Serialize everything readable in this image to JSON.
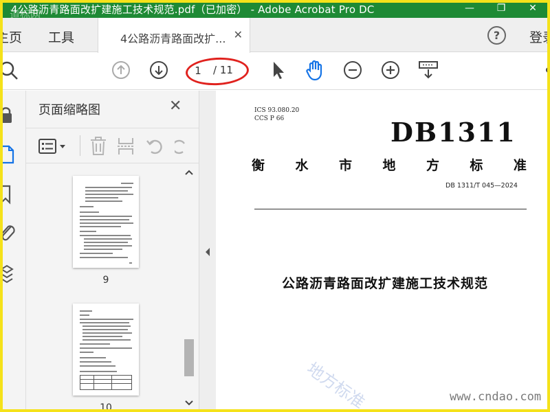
{
  "window": {
    "title": "4公路沥青路面改扩建施工技术规范.pdf（已加密） - Adobe Acrobat Pro DC",
    "watermark": "道标网",
    "minimize_glyph": "—",
    "restore_glyph": "❐",
    "close_glyph": "✕"
  },
  "menu": {
    "home": "主页",
    "tools": "工具",
    "doc_tab": "4公路沥青路面改扩...",
    "tab_close": "✕",
    "help": "?",
    "login": "登录"
  },
  "toolbar": {
    "current_page": "1",
    "total_pages": "/ 11"
  },
  "thumbnails": {
    "title": "页面缩略图",
    "close": "✕",
    "pages": [
      {
        "label": "9"
      },
      {
        "label": "10"
      }
    ]
  },
  "document": {
    "ics": "ICS  93.080.20",
    "ccs": "CCS  P 66",
    "db_code": "DB1311",
    "spaced_title": [
      "衡",
      "水",
      "市",
      "地",
      "方",
      "标",
      "准"
    ],
    "std_number": "DB 1311/T 045—2024",
    "title": "公路沥青路面改扩建施工技术规范",
    "watermark_diag": "地方标准",
    "watermark_url": "www.cndao.com"
  },
  "colors": {
    "titlebar": "#1e8a35",
    "frame": "#f5e21a",
    "annotation": "#e0221e",
    "hand_tool": "#1473e6"
  }
}
